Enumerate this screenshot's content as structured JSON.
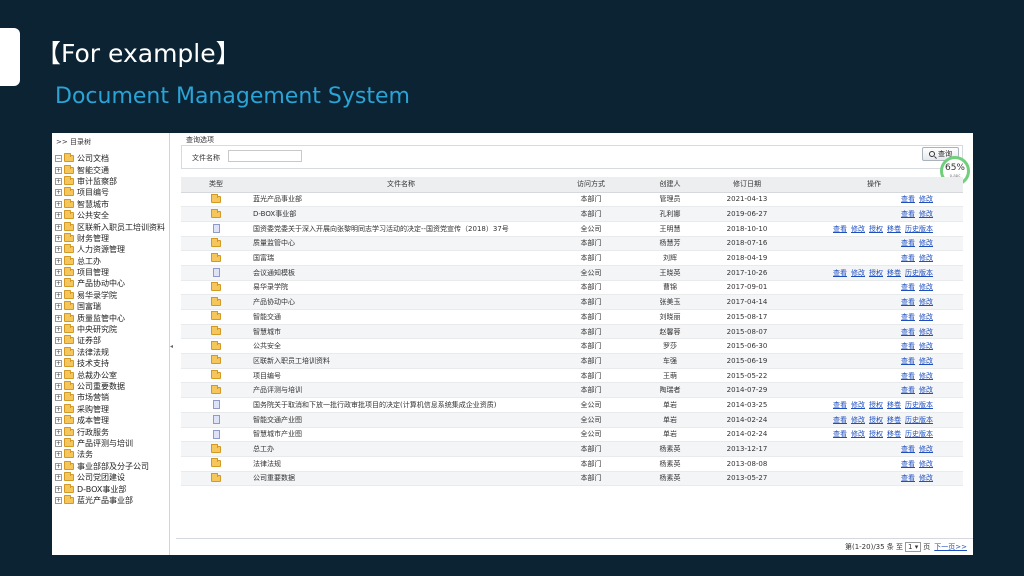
{
  "slide": {
    "heading": "【For example】",
    "subheading": "Document Management System"
  },
  "tree": {
    "header": ">> 目录树",
    "root": "公司文档",
    "items": [
      "智能交通",
      "审计监察部",
      "项目编号",
      "智慧城市",
      "公共安全",
      "区联新入职员工培训资料",
      "财务管理",
      "人力资源管理",
      "总工办",
      "项目管理",
      "产品协动中心",
      "易华录学院",
      "国富瑞",
      "质量监管中心",
      "中央研究院",
      "证券部",
      "法律法规",
      "技术支持",
      "总裁办公室",
      "公司重要数据",
      "市场营销",
      "采购管理",
      "成本管理",
      "行政服务",
      "产品评测与培训",
      "法务",
      "事业部部及分子公司",
      "公司党团建设",
      "D-BOX事业部",
      "蓝光产品事业部"
    ]
  },
  "query": {
    "section_label": "查询选项",
    "field_label": "文件名称",
    "input_value": "",
    "button_label": "查询"
  },
  "gauge": {
    "value": "65%",
    "sub": "o.apc"
  },
  "table": {
    "headers": [
      "类型",
      "文件名称",
      "访问方式",
      "创建人",
      "修订日期",
      "操作"
    ],
    "rows": [
      {
        "type": "folder",
        "name": "蓝光产品事业部",
        "access": "本部门",
        "creator": "管理员",
        "date": "2021-04-13",
        "actions": [
          "查看",
          "修改"
        ]
      },
      {
        "type": "folder",
        "name": "D-BOX事业部",
        "access": "本部门",
        "creator": "孔利娜",
        "date": "2019-06-27",
        "actions": [
          "查看",
          "修改"
        ]
      },
      {
        "type": "doc",
        "name": "国资委党委关于深入开展向张黎明同志学习活动的决定--国资党宣传（2018）37号",
        "access": "全公司",
        "creator": "王明慧",
        "date": "2018-10-10",
        "actions": [
          "查看",
          "修改",
          "授权",
          "移卷",
          "历史版本"
        ]
      },
      {
        "type": "folder",
        "name": "质量监管中心",
        "access": "本部门",
        "creator": "杨慧芳",
        "date": "2018-07-16",
        "actions": [
          "查看",
          "修改"
        ]
      },
      {
        "type": "folder",
        "name": "国富瑞",
        "access": "本部门",
        "creator": "刘辉",
        "date": "2018-04-19",
        "actions": [
          "查看",
          "修改"
        ]
      },
      {
        "type": "doc",
        "name": "会议通知模板",
        "access": "全公司",
        "creator": "王晓英",
        "date": "2017-10-26",
        "actions": [
          "查看",
          "修改",
          "授权",
          "移卷",
          "历史版本"
        ]
      },
      {
        "type": "folder",
        "name": "易华录学院",
        "access": "本部门",
        "creator": "曹锦",
        "date": "2017-09-01",
        "actions": [
          "查看",
          "修改"
        ]
      },
      {
        "type": "folder",
        "name": "产品协动中心",
        "access": "本部门",
        "creator": "张美玉",
        "date": "2017-04-14",
        "actions": [
          "查看",
          "修改"
        ]
      },
      {
        "type": "folder",
        "name": "智能交通",
        "access": "本部门",
        "creator": "刘晓丽",
        "date": "2015-08-17",
        "actions": [
          "查看",
          "修改"
        ]
      },
      {
        "type": "folder",
        "name": "智慧城市",
        "access": "本部门",
        "creator": "赵馨蓉",
        "date": "2015-08-07",
        "actions": [
          "查看",
          "修改"
        ]
      },
      {
        "type": "folder",
        "name": "公共安全",
        "access": "本部门",
        "creator": "罗莎",
        "date": "2015-06-30",
        "actions": [
          "查看",
          "修改"
        ]
      },
      {
        "type": "folder",
        "name": "区联新入职员工培训资料",
        "access": "本部门",
        "creator": "车强",
        "date": "2015-06-19",
        "actions": [
          "查看",
          "修改"
        ]
      },
      {
        "type": "folder",
        "name": "项目编号",
        "access": "本部门",
        "creator": "王萌",
        "date": "2015-05-22",
        "actions": [
          "查看",
          "修改"
        ]
      },
      {
        "type": "folder",
        "name": "产品评测与培训",
        "access": "本部门",
        "creator": "陶瑞者",
        "date": "2014-07-29",
        "actions": [
          "查看",
          "修改"
        ]
      },
      {
        "type": "doc",
        "name": "国务院关于取消和下放一批行政审批项目的决定(计算机信息系统集成企业资质)",
        "access": "全公司",
        "creator": "单岩",
        "date": "2014-03-25",
        "actions": [
          "查看",
          "修改",
          "授权",
          "移卷",
          "历史版本"
        ]
      },
      {
        "type": "doc",
        "name": "智能交通产业图",
        "access": "全公司",
        "creator": "单岩",
        "date": "2014-02-24",
        "actions": [
          "查看",
          "修改",
          "授权",
          "移卷",
          "历史版本"
        ]
      },
      {
        "type": "doc",
        "name": "智慧城市产业图",
        "access": "全公司",
        "creator": "单岩",
        "date": "2014-02-24",
        "actions": [
          "查看",
          "修改",
          "授权",
          "移卷",
          "历史版本"
        ]
      },
      {
        "type": "folder",
        "name": "总工办",
        "access": "本部门",
        "creator": "杨素英",
        "date": "2013-12-17",
        "actions": [
          "查看",
          "修改"
        ]
      },
      {
        "type": "folder",
        "name": "法律法规",
        "access": "本部门",
        "creator": "杨素英",
        "date": "2013-08-08",
        "actions": [
          "查看",
          "修改"
        ]
      },
      {
        "type": "folder",
        "name": "公司重要数据",
        "access": "本部门",
        "creator": "杨素英",
        "date": "2013-05-27",
        "actions": [
          "查看",
          "修改"
        ]
      }
    ]
  },
  "pagination": {
    "info": "第(1-20)/35 条 至",
    "page": "1",
    "unit": "页",
    "next": "下一页>>"
  }
}
